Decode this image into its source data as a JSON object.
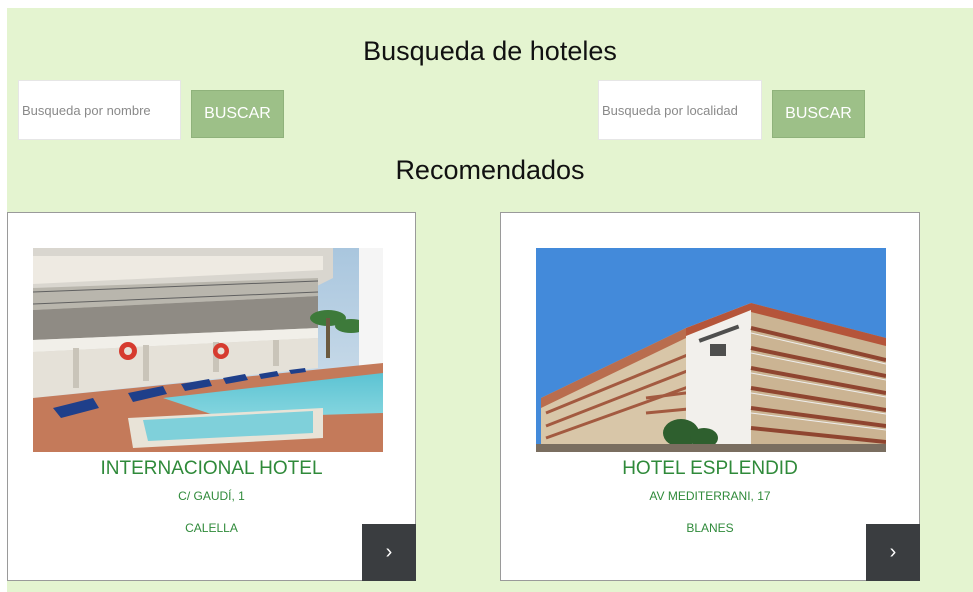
{
  "header": {
    "title": "Busqueda de hoteles"
  },
  "search": {
    "name_placeholder": "Busqueda por nombre",
    "location_placeholder": "Busqueda por localidad",
    "name_button_label": "BUSCAR",
    "location_button_label": "BUSCAR"
  },
  "recommended": {
    "title": "Recomendados",
    "hotels": [
      {
        "name": "INTERNACIONAL HOTEL",
        "address": "C/ GAUDÍ, 1",
        "city": "CALELLA",
        "arrow": "›"
      },
      {
        "name": "HOTEL ESPLENDID",
        "address": "AV MEDITERRANI, 17",
        "city": "BLANES",
        "arrow": "›"
      }
    ]
  },
  "colors": {
    "background": "#e4f4d0",
    "button": "#9dc088",
    "hotel_text": "#2f8a3a",
    "arrow_button": "#3a3d40"
  },
  "icons": {
    "card_arrow": "chevron-right-icon"
  }
}
